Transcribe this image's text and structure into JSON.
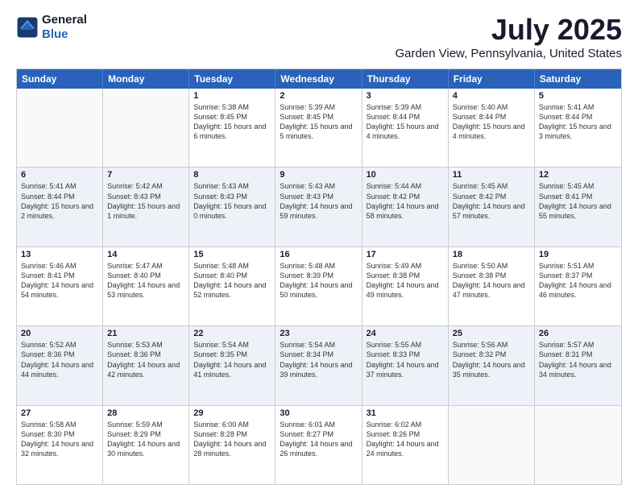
{
  "header": {
    "logo_general": "General",
    "logo_blue": "Blue",
    "title": "July 2025",
    "subtitle": "Garden View, Pennsylvania, United States"
  },
  "calendar": {
    "days": [
      "Sunday",
      "Monday",
      "Tuesday",
      "Wednesday",
      "Thursday",
      "Friday",
      "Saturday"
    ],
    "rows": [
      [
        {
          "day": "",
          "info": ""
        },
        {
          "day": "",
          "info": ""
        },
        {
          "day": "1",
          "info": "Sunrise: 5:38 AM\nSunset: 8:45 PM\nDaylight: 15 hours and 6 minutes."
        },
        {
          "day": "2",
          "info": "Sunrise: 5:39 AM\nSunset: 8:45 PM\nDaylight: 15 hours and 5 minutes."
        },
        {
          "day": "3",
          "info": "Sunrise: 5:39 AM\nSunset: 8:44 PM\nDaylight: 15 hours and 4 minutes."
        },
        {
          "day": "4",
          "info": "Sunrise: 5:40 AM\nSunset: 8:44 PM\nDaylight: 15 hours and 4 minutes."
        },
        {
          "day": "5",
          "info": "Sunrise: 5:41 AM\nSunset: 8:44 PM\nDaylight: 15 hours and 3 minutes."
        }
      ],
      [
        {
          "day": "6",
          "info": "Sunrise: 5:41 AM\nSunset: 8:44 PM\nDaylight: 15 hours and 2 minutes."
        },
        {
          "day": "7",
          "info": "Sunrise: 5:42 AM\nSunset: 8:43 PM\nDaylight: 15 hours and 1 minute."
        },
        {
          "day": "8",
          "info": "Sunrise: 5:43 AM\nSunset: 8:43 PM\nDaylight: 15 hours and 0 minutes."
        },
        {
          "day": "9",
          "info": "Sunrise: 5:43 AM\nSunset: 8:43 PM\nDaylight: 14 hours and 59 minutes."
        },
        {
          "day": "10",
          "info": "Sunrise: 5:44 AM\nSunset: 8:42 PM\nDaylight: 14 hours and 58 minutes."
        },
        {
          "day": "11",
          "info": "Sunrise: 5:45 AM\nSunset: 8:42 PM\nDaylight: 14 hours and 57 minutes."
        },
        {
          "day": "12",
          "info": "Sunrise: 5:45 AM\nSunset: 8:41 PM\nDaylight: 14 hours and 55 minutes."
        }
      ],
      [
        {
          "day": "13",
          "info": "Sunrise: 5:46 AM\nSunset: 8:41 PM\nDaylight: 14 hours and 54 minutes."
        },
        {
          "day": "14",
          "info": "Sunrise: 5:47 AM\nSunset: 8:40 PM\nDaylight: 14 hours and 53 minutes."
        },
        {
          "day": "15",
          "info": "Sunrise: 5:48 AM\nSunset: 8:40 PM\nDaylight: 14 hours and 52 minutes."
        },
        {
          "day": "16",
          "info": "Sunrise: 5:48 AM\nSunset: 8:39 PM\nDaylight: 14 hours and 50 minutes."
        },
        {
          "day": "17",
          "info": "Sunrise: 5:49 AM\nSunset: 8:38 PM\nDaylight: 14 hours and 49 minutes."
        },
        {
          "day": "18",
          "info": "Sunrise: 5:50 AM\nSunset: 8:38 PM\nDaylight: 14 hours and 47 minutes."
        },
        {
          "day": "19",
          "info": "Sunrise: 5:51 AM\nSunset: 8:37 PM\nDaylight: 14 hours and 46 minutes."
        }
      ],
      [
        {
          "day": "20",
          "info": "Sunrise: 5:52 AM\nSunset: 8:36 PM\nDaylight: 14 hours and 44 minutes."
        },
        {
          "day": "21",
          "info": "Sunrise: 5:53 AM\nSunset: 8:36 PM\nDaylight: 14 hours and 42 minutes."
        },
        {
          "day": "22",
          "info": "Sunrise: 5:54 AM\nSunset: 8:35 PM\nDaylight: 14 hours and 41 minutes."
        },
        {
          "day": "23",
          "info": "Sunrise: 5:54 AM\nSunset: 8:34 PM\nDaylight: 14 hours and 39 minutes."
        },
        {
          "day": "24",
          "info": "Sunrise: 5:55 AM\nSunset: 8:33 PM\nDaylight: 14 hours and 37 minutes."
        },
        {
          "day": "25",
          "info": "Sunrise: 5:56 AM\nSunset: 8:32 PM\nDaylight: 14 hours and 35 minutes."
        },
        {
          "day": "26",
          "info": "Sunrise: 5:57 AM\nSunset: 8:31 PM\nDaylight: 14 hours and 34 minutes."
        }
      ],
      [
        {
          "day": "27",
          "info": "Sunrise: 5:58 AM\nSunset: 8:30 PM\nDaylight: 14 hours and 32 minutes."
        },
        {
          "day": "28",
          "info": "Sunrise: 5:59 AM\nSunset: 8:29 PM\nDaylight: 14 hours and 30 minutes."
        },
        {
          "day": "29",
          "info": "Sunrise: 6:00 AM\nSunset: 8:28 PM\nDaylight: 14 hours and 28 minutes."
        },
        {
          "day": "30",
          "info": "Sunrise: 6:01 AM\nSunset: 8:27 PM\nDaylight: 14 hours and 26 minutes."
        },
        {
          "day": "31",
          "info": "Sunrise: 6:02 AM\nSunset: 8:26 PM\nDaylight: 14 hours and 24 minutes."
        },
        {
          "day": "",
          "info": ""
        },
        {
          "day": "",
          "info": ""
        }
      ]
    ]
  }
}
